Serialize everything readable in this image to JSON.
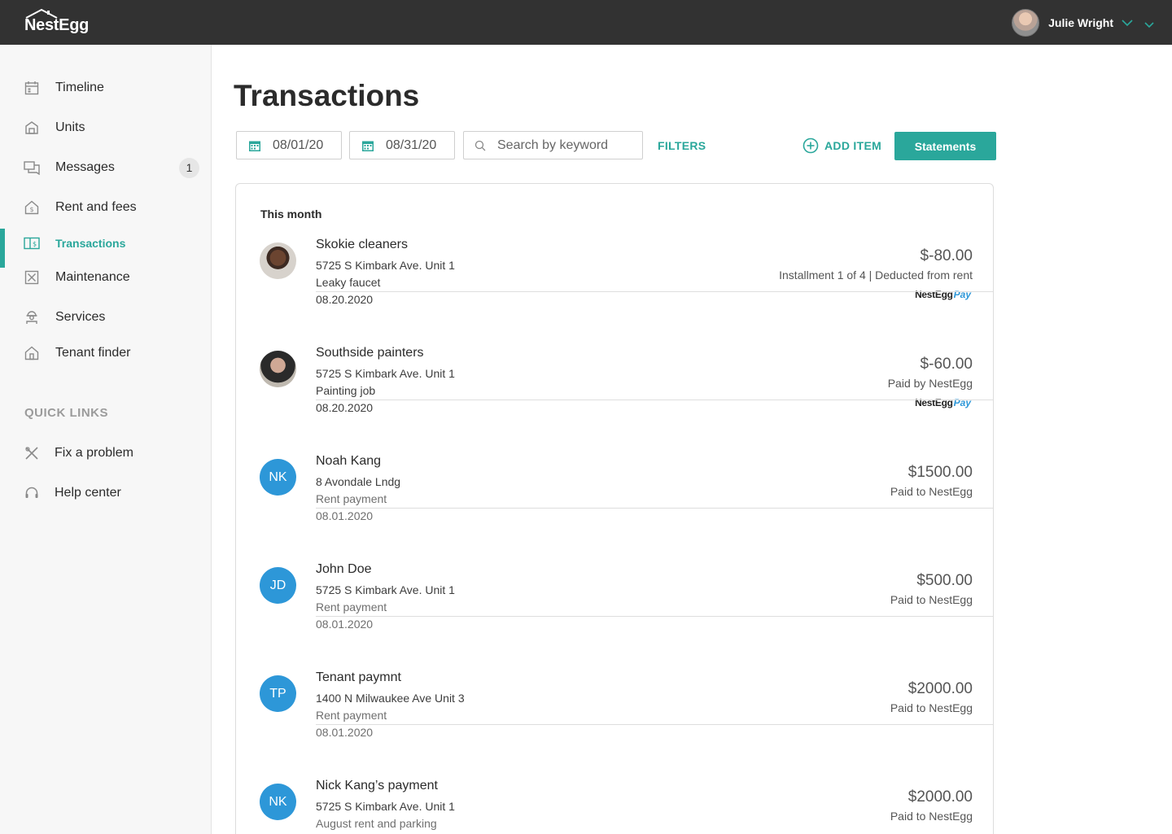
{
  "app": {
    "logo": "NestEgg"
  },
  "user": {
    "name": "Julie Wright"
  },
  "sidebar": {
    "items": [
      {
        "label": "Timeline",
        "icon": "calendar-icon"
      },
      {
        "label": "Units",
        "icon": "store-icon"
      },
      {
        "label": "Messages",
        "icon": "chat-icon",
        "badge": "1"
      },
      {
        "label": "Rent and fees",
        "icon": "house-dollar-icon"
      },
      {
        "label": "Transactions",
        "icon": "receipt-icon",
        "active": true
      },
      {
        "label": "Maintenance",
        "icon": "tools-box-icon"
      },
      {
        "label": "Services",
        "icon": "worker-icon"
      },
      {
        "label": "Tenant finder",
        "icon": "house-search-icon"
      }
    ],
    "quick_links_title": "QUICK LINKS",
    "quick_links": [
      {
        "label": "Fix a problem",
        "icon": "wrench-icon"
      },
      {
        "label": "Help center",
        "icon": "headset-icon"
      }
    ]
  },
  "main": {
    "title": "Transactions",
    "date_from": "08/01/20",
    "date_to": "08/31/20",
    "search_placeholder": "Search by keyword",
    "filters_label": "FILTERS",
    "add_item_label": "ADD ITEM",
    "statements_label": "Statements",
    "section_label": "This month",
    "pay_logo": {
      "brand": "NestEgg",
      "suffix": "Pay"
    },
    "accent_color": "#2aa79b",
    "transactions": [
      {
        "name": "Skokie cleaners",
        "address": "5725 S Kimbark Ave. Unit 1",
        "description": "Leaky faucet",
        "date": "08.20.2020",
        "amount": "$-80.00",
        "note": "Installment 1 of 4 |  Deducted from rent",
        "avatar": "photo",
        "nestegg_pay": true
      },
      {
        "name": "Southside painters",
        "address": "5725 S Kimbark Ave. Unit 1",
        "description": "Painting job",
        "date": "08.20.2020",
        "amount": "$-60.00",
        "note": "Paid by NestEgg",
        "avatar": "photo",
        "nestegg_pay": true
      },
      {
        "name": "Noah Kang",
        "address": "8 Avondale Lndg",
        "description": "Rent payment",
        "date": "08.01.2020",
        "amount": "$1500.00",
        "note": "Paid to NestEgg",
        "initials": "NK"
      },
      {
        "name": "John Doe",
        "address": "5725 S Kimbark Ave. Unit 1",
        "description": "Rent payment",
        "date": "08.01.2020",
        "amount": "$500.00",
        "note": "Paid to NestEgg",
        "initials": "JD"
      },
      {
        "name": "Tenant paymnt",
        "address": "1400 N Milwaukee Ave Unit 3",
        "description": "Rent payment",
        "date": "08.01.2020",
        "amount": "$2000.00",
        "note": "Paid to NestEgg",
        "initials": "TP"
      },
      {
        "name": "Nick Kang’s payment",
        "address": "5725 S Kimbark Ave. Unit 1",
        "description": "August rent and parking",
        "date": "",
        "amount": "$2000.00",
        "note": "Paid to NestEgg",
        "initials": "NK"
      }
    ]
  }
}
